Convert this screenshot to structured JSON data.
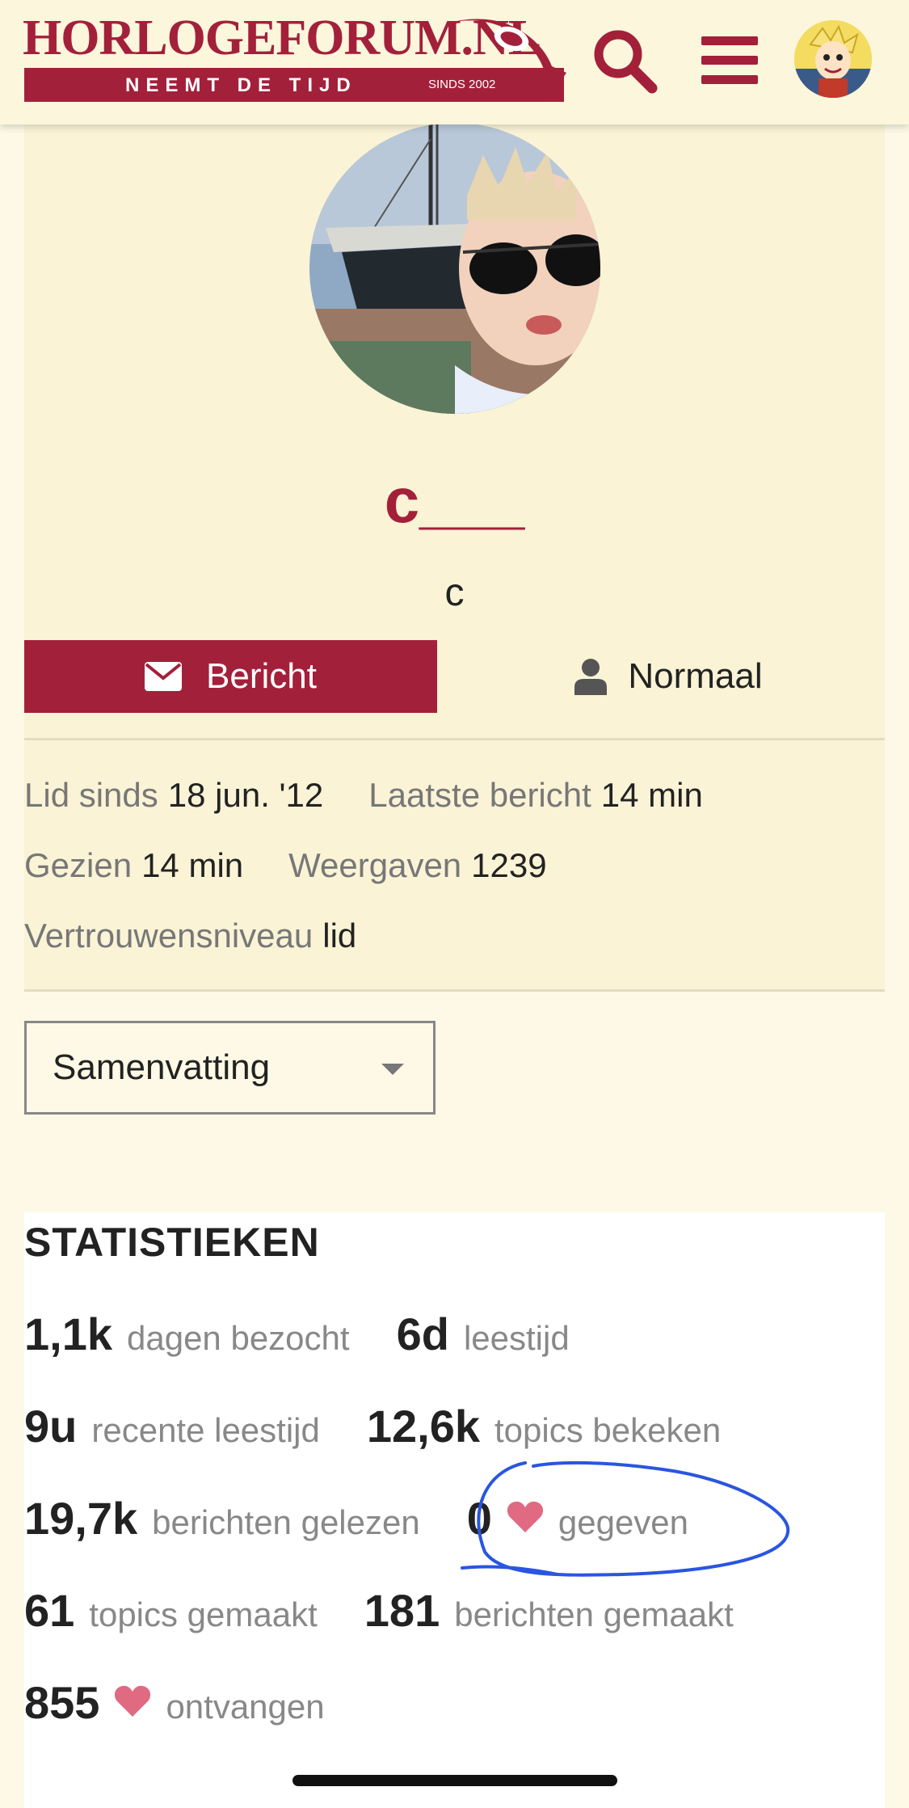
{
  "header": {
    "logo_title": "HORLOGEFORUM.NL",
    "logo_tagline": "NEEMT DE TIJD",
    "logo_since": "SINDS 2002",
    "search_icon": "search-icon",
    "menu_icon": "hamburger-menu-icon"
  },
  "profile": {
    "username": "c___",
    "fullname": "c",
    "message_button": "Bericht",
    "notification_level": "Normaal",
    "info": {
      "member_since_label": "Lid sinds",
      "member_since_value": "18 jun. '12",
      "last_post_label": "Laatste bericht",
      "last_post_value": "14 min",
      "seen_label": "Gezien",
      "seen_value": "14 min",
      "views_label": "Weergaven",
      "views_value": "1239",
      "trust_label": "Vertrouwensniveau",
      "trust_value": "lid"
    }
  },
  "dropdown": {
    "selected": "Samenvatting"
  },
  "stats": {
    "title": "STATISTIEKEN",
    "days_visited_num": "1,1k",
    "days_visited_label": "dagen bezocht",
    "read_time_num": "6d",
    "read_time_label": "leestijd",
    "recent_read_num": "9u",
    "recent_read_label": "recente leestijd",
    "topics_viewed_num": "12,6k",
    "topics_viewed_label": "topics bekeken",
    "posts_read_num": "19,7k",
    "posts_read_label": "berichten gelezen",
    "likes_given_num": "0",
    "likes_given_label": "gegeven",
    "topics_created_num": "61",
    "topics_created_label": "topics gemaakt",
    "posts_created_num": "181",
    "posts_created_label": "berichten gemaakt",
    "likes_received_num": "855",
    "likes_received_label": "ontvangen"
  },
  "colors": {
    "brand": "#a3203a",
    "heart": "#e06a82",
    "annotation": "#2a55e0"
  }
}
